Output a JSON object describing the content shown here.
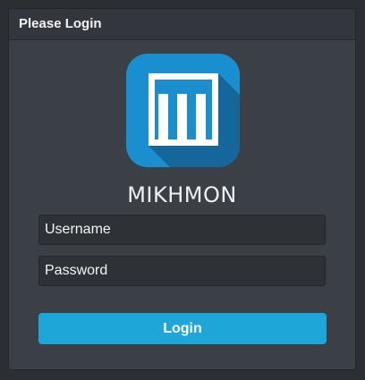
{
  "panel": {
    "title": "Please Login"
  },
  "app": {
    "name": "MIKHMON",
    "logo_icon": "mikhmon-logo-icon"
  },
  "form": {
    "username_placeholder": "Username",
    "username_value": "",
    "password_placeholder": "Password",
    "password_value": "",
    "login_label": "Login"
  },
  "colors": {
    "background": "#2b2e33",
    "panel": "#3b4047",
    "panel_header": "#33373d",
    "input_bg": "#2e3136",
    "accent": "#1fa6d8",
    "logo_bg": "#1a8fcf"
  }
}
